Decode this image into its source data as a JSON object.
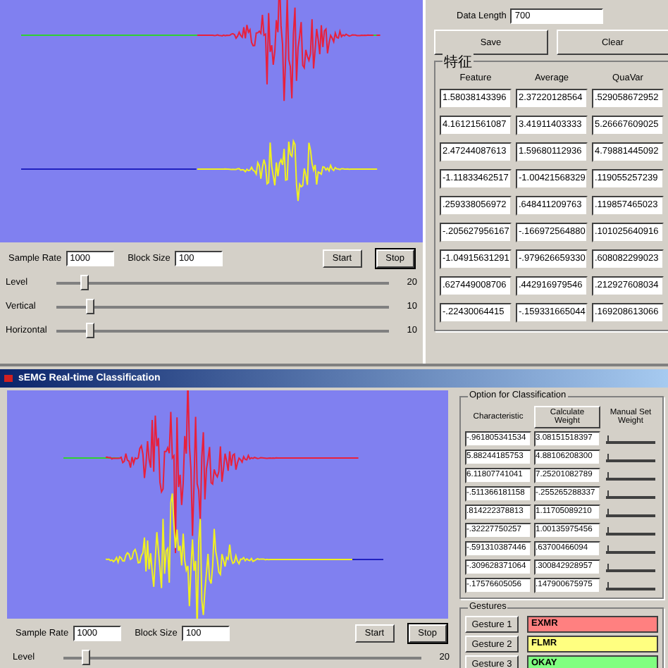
{
  "acquisition_window": {
    "data_length": {
      "label": "Data Length",
      "value": "700"
    },
    "buttons": [
      "Save",
      "Clear"
    ],
    "feature_group": {
      "title": "特征",
      "columns": [
        "Feature",
        "Average",
        "QuaVar"
      ],
      "rows": [
        [
          "1.58038143396",
          "2.37220128564",
          ".529058672952"
        ],
        [
          "4.16121561087",
          "3.41911403333",
          "5.26667609025"
        ],
        [
          "2.47244087613",
          "1.59680112936",
          "4.79881445092"
        ],
        [
          "-1.11833462517",
          "-1.00421568329",
          ".119055257239"
        ],
        [
          ".259338056972",
          ".648411209763",
          ".119857465023"
        ],
        [
          "-.205627956167",
          "-.166972564880",
          ".101025640916"
        ],
        [
          "-1.04915631291",
          "-.979626659330",
          ".608082299023"
        ],
        [
          ".627449008706",
          ".442916979546",
          ".212927608034"
        ],
        [
          "-.22430064415",
          "-.159331665044",
          ".169208613066"
        ]
      ]
    },
    "sample_rate": {
      "label": "Sample Rate",
      "value": "1000"
    },
    "block_size": {
      "label": "Block Size",
      "value": "100"
    },
    "controls": [
      "Start",
      "Stop"
    ],
    "sliders": [
      {
        "label": "Level",
        "level": 0.07,
        "reading": "20"
      },
      {
        "label": "Vertical",
        "level": 0.09,
        "reading": "10"
      },
      {
        "label": "Horizontal",
        "level": 0.09,
        "reading": "10"
      }
    ]
  },
  "classification_window": {
    "title": "sEMG Real-time Classification",
    "option_group": {
      "title": "Option for Classification",
      "characteristic_header": "Characteristic",
      "calculate_button": "Calculate Weight",
      "manual_header": "Manual Set Weight",
      "rows": [
        {
          "characteristic": "-.961805341534",
          "weight": "3.08151518397",
          "level": 0.02
        },
        {
          "characteristic": "5.88244185753",
          "weight": "4.88106208300",
          "level": 0.02
        },
        {
          "characteristic": "6.11807741041",
          "weight": "7.25201082789",
          "level": 0.02
        },
        {
          "characteristic": "-.511366181158",
          "weight": "-.255265288337",
          "level": 0.02
        },
        {
          "characteristic": ".814222378813",
          "weight": "1.11705089210",
          "level": 0.02
        },
        {
          "characteristic": "-.32227750257",
          "weight": "1.00135975456",
          "level": 0.02
        },
        {
          "characteristic": "-.591310387446",
          "weight": ".63700466094",
          "level": 0.02
        },
        {
          "characteristic": "-.309628371064",
          "weight": ".300842928957",
          "level": 0.02
        },
        {
          "characteristic": "-.17576605056",
          "weight": ".147900675975",
          "level": 0.02
        }
      ]
    },
    "gestures": {
      "title": "Gestures",
      "items": [
        {
          "label": "Gesture 1",
          "result": "EXMR",
          "color": "#ff8080"
        },
        {
          "label": "Gesture 2",
          "result": "FLMR",
          "color": "#ffff80"
        },
        {
          "label": "Gesture 3",
          "result": "OKAY",
          "color": "#80ff80"
        }
      ]
    },
    "sample_rate": {
      "label": "Sample Rate",
      "value": "1000"
    },
    "block_size": {
      "label": "Block Size",
      "value": "100"
    },
    "controls": [
      "Start",
      "Stop"
    ],
    "sliders": [
      {
        "label": "Level",
        "level": 0.05,
        "reading": "20"
      }
    ]
  }
}
